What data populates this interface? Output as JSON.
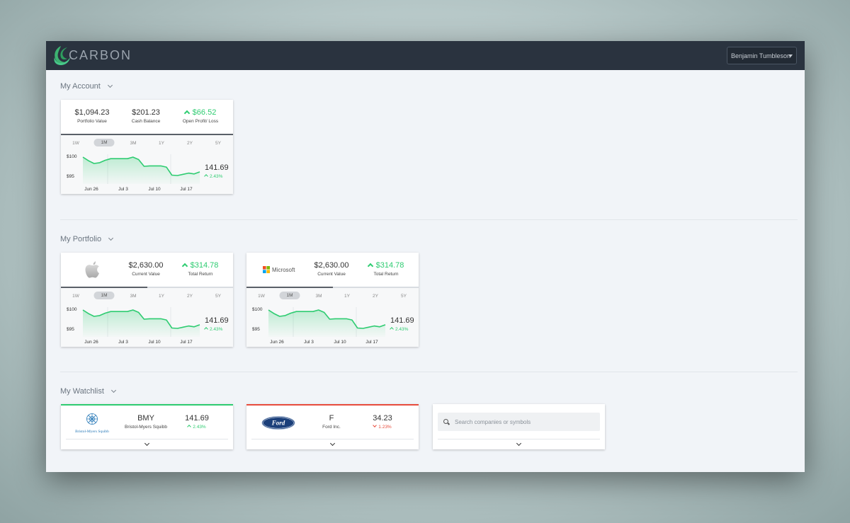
{
  "app": {
    "brand": "CARBON",
    "user": "Benjamin Tumbleson"
  },
  "sections": {
    "account": "My Account",
    "portfolio": "My Portfolio",
    "watchlist": "My Watchlist"
  },
  "ranges": [
    "1W",
    "1M",
    "3M",
    "1Y",
    "2Y",
    "5Y"
  ],
  "active_range": "1M",
  "account": {
    "stats": [
      {
        "value": "$1,094.23",
        "label": "Portfolio Value"
      },
      {
        "value": "$201.23",
        "label": "Cash Balance"
      },
      {
        "value": "$66.52",
        "label": "Open Profit/ Loss"
      }
    ],
    "price": "141.69",
    "change": "2.43%"
  },
  "portfolio": [
    {
      "company": "Apple",
      "stats": [
        {
          "value": "$2,630.00",
          "label": "Current Value"
        },
        {
          "value": "$314.78",
          "label": "Total Return"
        }
      ],
      "price": "141.69",
      "change": "2.43%"
    },
    {
      "company": "Microsoft",
      "stats": [
        {
          "value": "$2,630.00",
          "label": "Current Value"
        },
        {
          "value": "$314.78",
          "label": "Total Return"
        }
      ],
      "price": "141.69",
      "change": "2.43%"
    }
  ],
  "chart_data": {
    "type": "area",
    "x": [
      "Jun 26",
      "Jul 3",
      "Jul 10",
      "Jul 17"
    ],
    "y_ticks": [
      "$100",
      "$95"
    ],
    "ylim": [
      94.5,
      100.5
    ],
    "points": [
      99.8,
      98.9,
      98.2,
      98.4,
      99.0,
      99.4,
      99.4,
      99.4,
      99.4,
      99.8,
      99.2,
      97.5,
      97.6,
      97.6,
      97.6,
      97.3,
      95.3,
      95.2,
      95.5,
      95.8,
      95.6,
      96.1
    ],
    "color": "#2ecc71"
  },
  "watchlist": [
    {
      "logo": "Bristol-Myers Squibb",
      "symbol": "BMY",
      "name": "Bristol-Myers Squibb",
      "price": "141.69",
      "change": "2.43%",
      "direction": "up",
      "accent": "#2ecc71"
    },
    {
      "logo": "Ford",
      "symbol": "F",
      "name": "Ford Inc.",
      "price": "34.23",
      "change": "1.23%",
      "direction": "down",
      "accent": "#e74c3c"
    }
  ],
  "search": {
    "placeholder": "Search companies or symbols"
  }
}
